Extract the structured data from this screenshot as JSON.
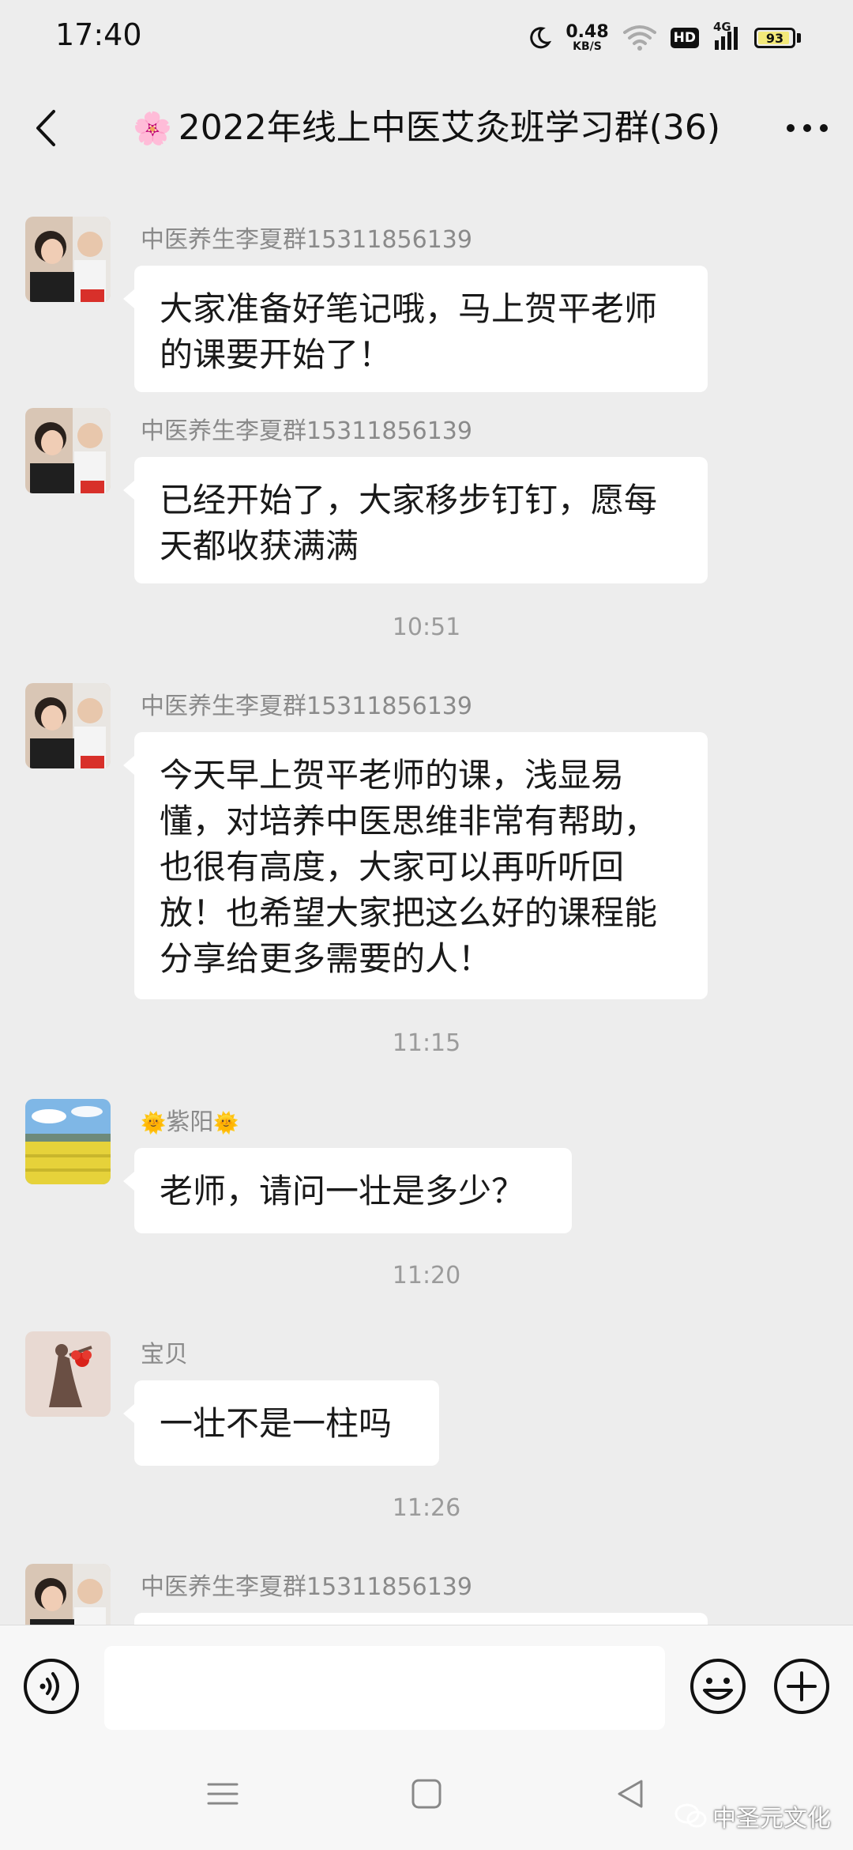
{
  "status_bar": {
    "time": "17:40",
    "net_speed_value": "0.48",
    "net_speed_unit": "KB/S",
    "hd": "HD",
    "network": "4G",
    "battery": "93",
    "battery_level": 0.93
  },
  "header": {
    "title": "2022年线上中医艾灸班学习群(36)",
    "title_emoji": "🌸",
    "back_icon": "chevron-left-icon",
    "more_icon": "more-dots-icon"
  },
  "messages": [
    {
      "sender": "中医养生李夏群15311856139",
      "text": "大家准备好笔记哦，马上贺平老师的课要开始了！"
    },
    {
      "sender": "中医养生李夏群15311856139",
      "text": "已经开始了，大家移步钉钉，愿每天都收获满满"
    },
    {
      "timestamp": "10:51"
    },
    {
      "sender": "中医养生李夏群15311856139",
      "text": "今天早上贺平老师的课，浅显易懂，对培养中医思维非常有帮助，也很有高度，大家可以再听听回放！也希望大家把这么好的课程能分享给更多需要的人！"
    },
    {
      "timestamp": "11:15"
    },
    {
      "sender": "紫阳",
      "sender_prefix": "🌞",
      "sender_suffix": "🌞",
      "text": "老师，请问一壮是多少？"
    },
    {
      "timestamp": "11:20"
    },
    {
      "sender": "宝贝",
      "text": "一壮不是一柱吗"
    },
    {
      "timestamp": "11:26"
    },
    {
      "sender": "中医养生李夏群15311856139",
      "text": ""
    }
  ],
  "input_bar": {
    "placeholder": "",
    "voice_icon": "voice-icon",
    "emoji_icon": "emoji-icon",
    "plus_icon": "plus-icon"
  },
  "nav_bar": {
    "menu_icon": "menu-icon",
    "home_icon": "home-icon",
    "back_icon": "back-triangle-icon"
  },
  "watermark": {
    "text": "中圣元文化"
  },
  "colors": {
    "background": "#ededed",
    "bubble": "#ffffff",
    "sender": "#8a8a8a",
    "timestamp": "#9b9b9b"
  }
}
